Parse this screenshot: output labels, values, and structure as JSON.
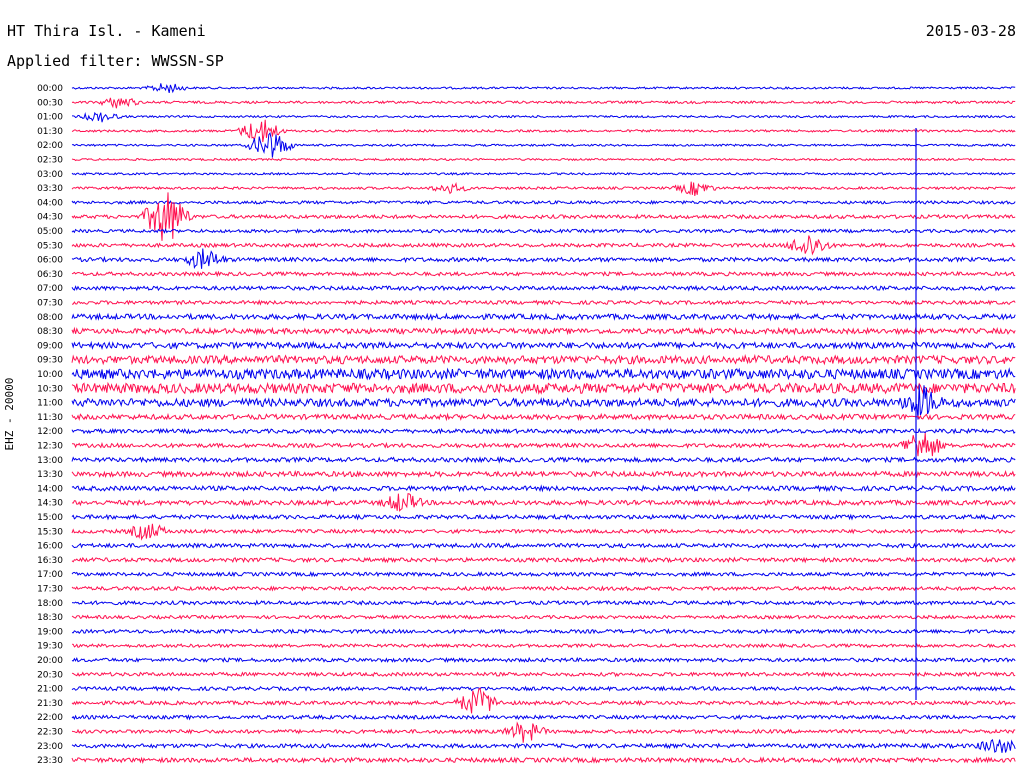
{
  "header": {
    "station": "HT Thira Isl. - Kameni",
    "date": "2015-03-28",
    "filter": "Applied filter: WWSSN-SP"
  },
  "chart_data": {
    "type": "line",
    "title": "HT Thira Isl. - Kameni",
    "ylabel": "EHZ - 20000",
    "colors": [
      "#0000ee",
      "#ff1150"
    ],
    "grid": false,
    "trace_amplitude": [
      1.0,
      1.2,
      1.0,
      1.1,
      1.0,
      1.0,
      1.0,
      1.2,
      1.5,
      1.8,
      1.6,
      1.8,
      2.0,
      1.8,
      2.0,
      1.8,
      2.6,
      2.6,
      3.0,
      4.0,
      5.0,
      5.0,
      4.0,
      2.5,
      2.0,
      2.0,
      2.2,
      2.5,
      2.3,
      2.3,
      2.0,
      1.8,
      2.0,
      2.0,
      1.8,
      1.8,
      1.8,
      1.6,
      1.8,
      1.6,
      1.8,
      1.8,
      1.8,
      1.8,
      1.8,
      1.8,
      2.0,
      2.2
    ],
    "events": [
      {
        "row": "00:00",
        "pos": 0.1,
        "amp": 6
      },
      {
        "row": "00:30",
        "pos": 0.05,
        "amp": 7
      },
      {
        "row": "01:00",
        "pos": 0.03,
        "amp": 6
      },
      {
        "row": "01:30",
        "pos": 0.2,
        "amp": 14
      },
      {
        "row": "02:00",
        "pos": 0.21,
        "amp": 16
      },
      {
        "row": "03:30",
        "pos": 0.4,
        "amp": 6
      },
      {
        "row": "03:30",
        "pos": 0.66,
        "amp": 8
      },
      {
        "row": "04:30",
        "pos": 0.1,
        "amp": 30
      },
      {
        "row": "06:00",
        "pos": 0.14,
        "amp": 12
      },
      {
        "row": "05:30",
        "pos": 0.78,
        "amp": 14
      },
      {
        "row": "11:00",
        "pos": 0.9,
        "amp": 20
      },
      {
        "row": "12:30",
        "pos": 0.9,
        "amp": 18
      },
      {
        "row": "14:30",
        "pos": 0.35,
        "amp": 12
      },
      {
        "row": "15:30",
        "pos": 0.08,
        "amp": 10
      },
      {
        "row": "21:30",
        "pos": 0.43,
        "amp": 16
      },
      {
        "row": "22:30",
        "pos": 0.48,
        "amp": 12
      },
      {
        "row": "23:00",
        "pos": 0.98,
        "amp": 10
      }
    ],
    "rows": [
      "00:00",
      "00:30",
      "01:00",
      "01:30",
      "02:00",
      "02:30",
      "03:00",
      "03:30",
      "04:00",
      "04:30",
      "05:00",
      "05:30",
      "06:00",
      "06:30",
      "07:00",
      "07:30",
      "08:00",
      "08:30",
      "09:00",
      "09:30",
      "10:00",
      "10:30",
      "11:00",
      "11:30",
      "12:00",
      "12:30",
      "13:00",
      "13:30",
      "14:00",
      "14:30",
      "15:00",
      "15:30",
      "16:00",
      "16:30",
      "17:00",
      "17:30",
      "18:00",
      "18:30",
      "19:00",
      "19:30",
      "20:00",
      "20:30",
      "21:00",
      "21:30",
      "22:00",
      "22:30",
      "23:00",
      "23:30"
    ]
  }
}
